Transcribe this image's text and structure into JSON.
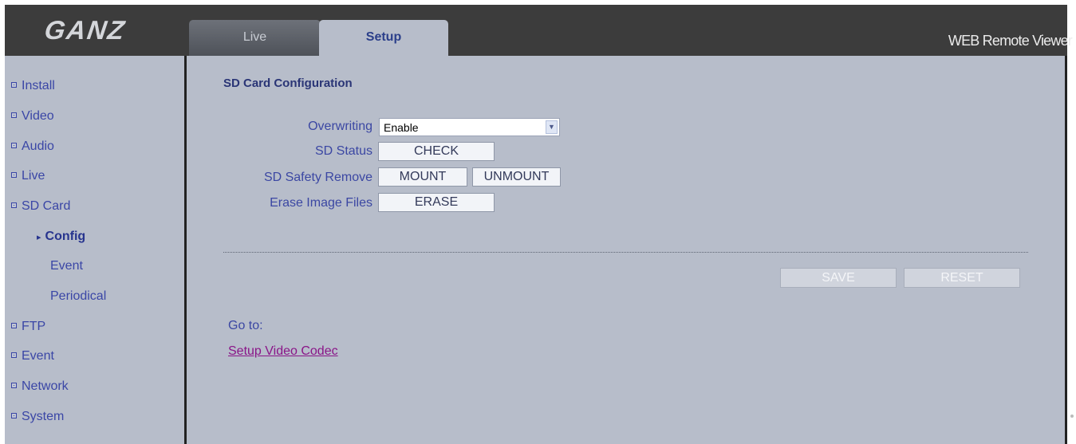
{
  "header": {
    "logo": "GANZ",
    "app_title": "WEB Remote Viewer",
    "tabs": [
      {
        "label": "Live",
        "active": false
      },
      {
        "label": "Setup",
        "active": true
      }
    ]
  },
  "sidebar": {
    "items": [
      {
        "label": "Install"
      },
      {
        "label": "Video"
      },
      {
        "label": "Audio"
      },
      {
        "label": "Live"
      },
      {
        "label": "SD Card"
      },
      {
        "label": "FTP"
      },
      {
        "label": "Event"
      },
      {
        "label": "Network"
      },
      {
        "label": "System"
      }
    ],
    "sd_card_subitems": [
      {
        "label": "Config",
        "active": true,
        "marker": "▸"
      },
      {
        "label": "Event",
        "active": false
      },
      {
        "label": "Periodical",
        "active": false
      }
    ]
  },
  "main": {
    "section_title": "SD Card Configuration",
    "form": {
      "overwriting_label": "Overwriting",
      "overwriting_value": "Enable",
      "sd_status_label": "SD Status",
      "check_button": "CHECK",
      "safety_remove_label": "SD Safety Remove",
      "mount_button": "MOUNT",
      "unmount_button": "UNMOUNT",
      "erase_label": "Erase Image Files",
      "erase_button": "ERASE"
    },
    "save_button": "SAVE",
    "reset_button": "RESET",
    "goto_label": "Go to:",
    "goto_link": "Setup Video Codec"
  },
  "colors": {
    "header_bg": "#3c3c3c",
    "panel_bg": "#b7bdca",
    "nav_text": "#3a46a6",
    "title_text": "#2a3576",
    "link": "#8a1588"
  }
}
